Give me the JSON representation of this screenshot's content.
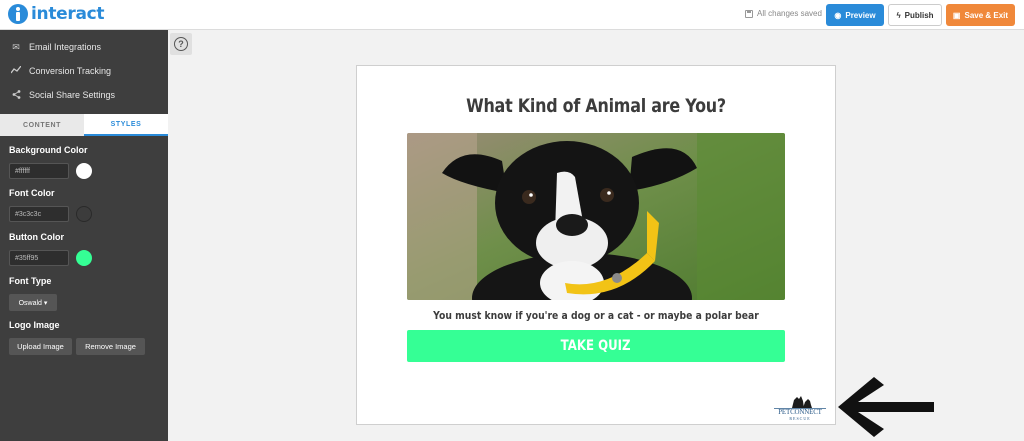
{
  "app": {
    "brand": "interact",
    "status": "All changes saved",
    "buttons": {
      "preview": "Preview",
      "publish": "Publish",
      "save": "Save & Exit"
    }
  },
  "sidebar": {
    "menu": [
      {
        "label": "Email Integrations",
        "icon": "envelope-icon"
      },
      {
        "label": "Conversion Tracking",
        "icon": "line-chart-icon"
      },
      {
        "label": "Social Share Settings",
        "icon": "share-icon"
      }
    ],
    "tabs": {
      "content": "CONTENT",
      "styles": "STYLES"
    },
    "styles": {
      "background_color": {
        "label": "Background Color",
        "value": "#ffffff",
        "swatch": "#ffffff"
      },
      "font_color": {
        "label": "Font Color",
        "value": "#3c3c3c",
        "swatch": "#3c3c3c"
      },
      "button_color": {
        "label": "Button Color",
        "value": "#35ff95",
        "swatch": "#35ff95"
      },
      "font_type": {
        "label": "Font Type",
        "value": "Oswald ▾"
      },
      "logo_image": {
        "label": "Logo Image",
        "upload": "Upload Image",
        "remove": "Remove Image"
      }
    }
  },
  "help": {
    "glyph": "?"
  },
  "quiz": {
    "title": "What Kind of Animal are You?",
    "description": "You must know if you're a dog or a cat - or maybe a polar bear",
    "button": "TAKE QUIZ",
    "logo": {
      "word": "PETCONNECT",
      "sub": "RESCUE"
    }
  },
  "colors": {
    "accent": "#2a8bd9",
    "save": "#f0883a",
    "quiz_button": "#35ff95",
    "font": "#3c3c3c"
  }
}
